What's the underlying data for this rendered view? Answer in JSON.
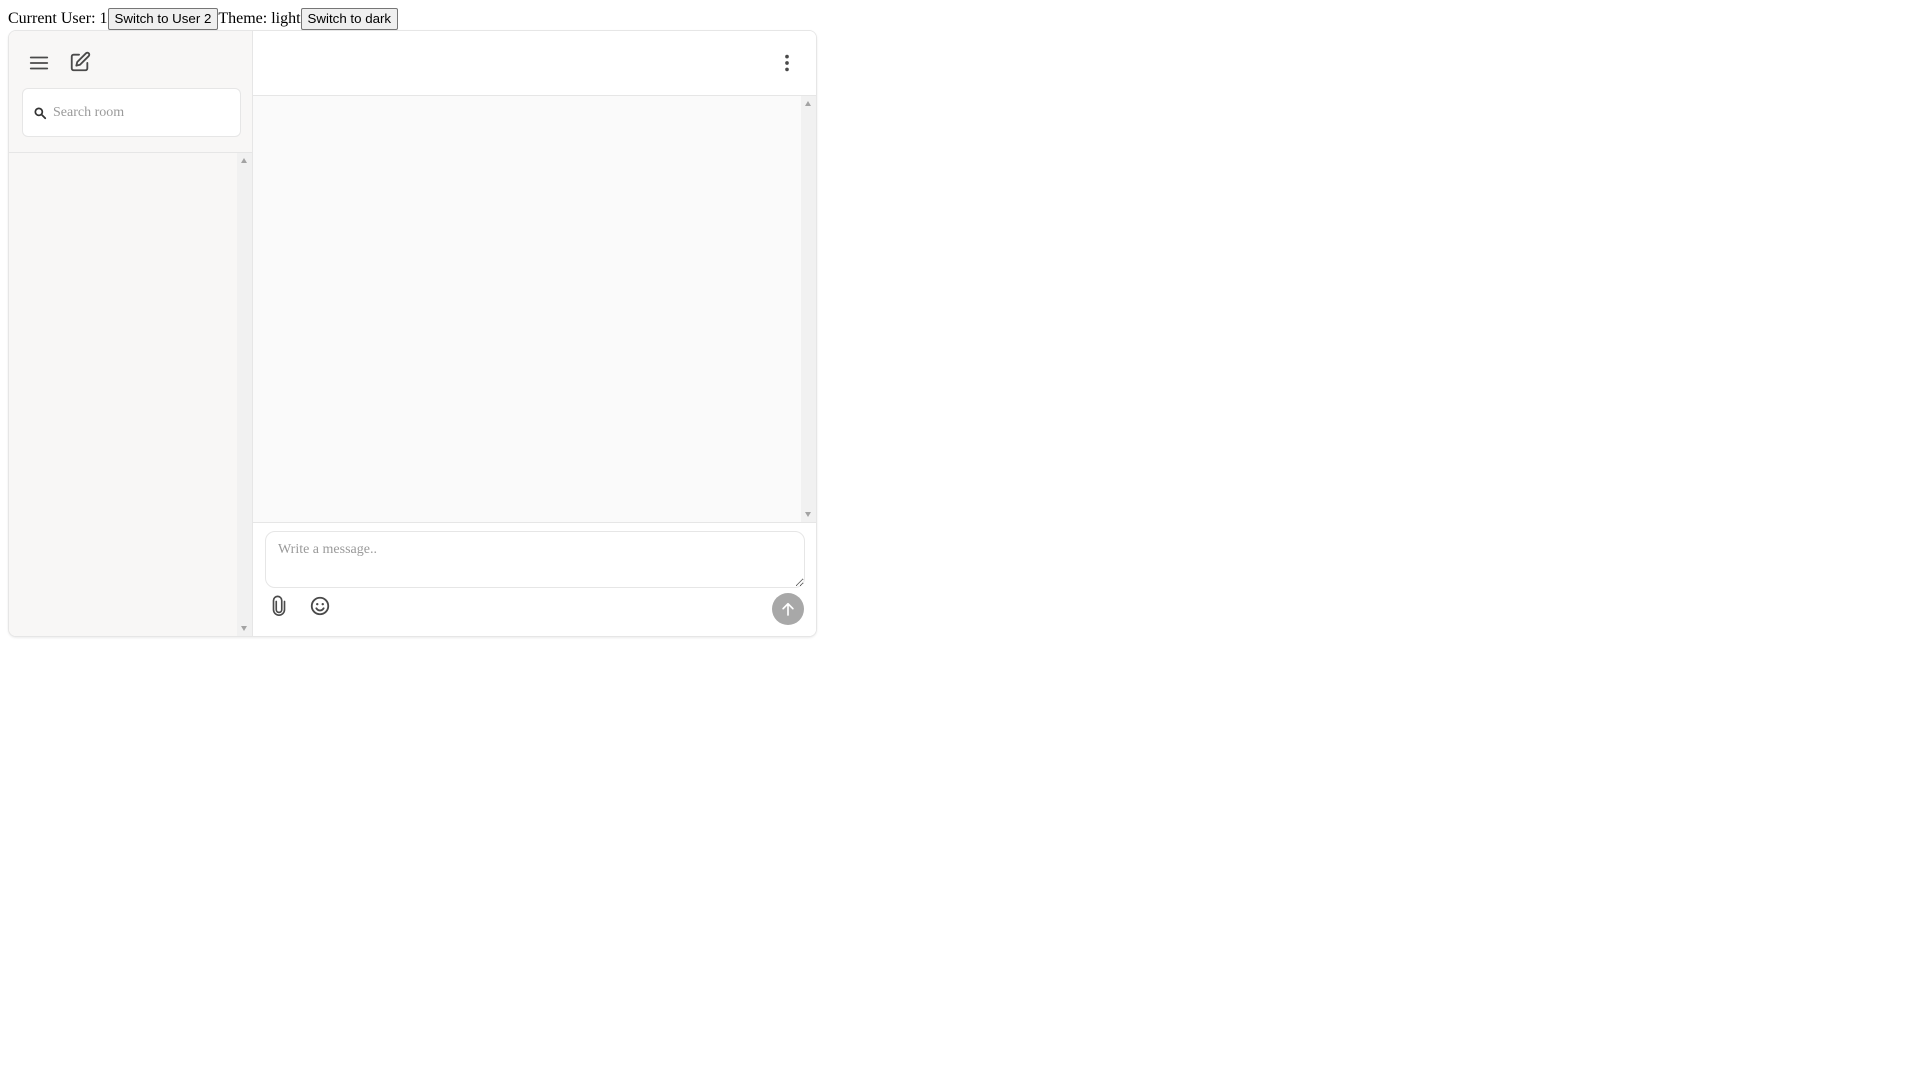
{
  "topbar": {
    "current_user_label": "Current User: 1",
    "switch_user_label": "Switch to User 2",
    "theme_label": "Theme: light",
    "switch_theme_label": "Switch to dark"
  },
  "rooms": {
    "menu_icon": "menu-icon",
    "new_room_icon": "edit-icon",
    "search": {
      "placeholder": "Search room",
      "value": ""
    },
    "items": []
  },
  "chat": {
    "more_icon": "more-vertical-icon",
    "messages": [],
    "composer": {
      "placeholder": "Write a message..",
      "value": "",
      "attach_icon": "paperclip-icon",
      "emoji_icon": "emoji-icon",
      "send_icon": "arrow-up-icon"
    }
  },
  "colors": {
    "panel_bg": "#f8f7f6",
    "messages_bg": "#fafafa",
    "border": "#e6e6e6",
    "send_button": "#a8a8a8",
    "icon": "#4a4a4a"
  }
}
